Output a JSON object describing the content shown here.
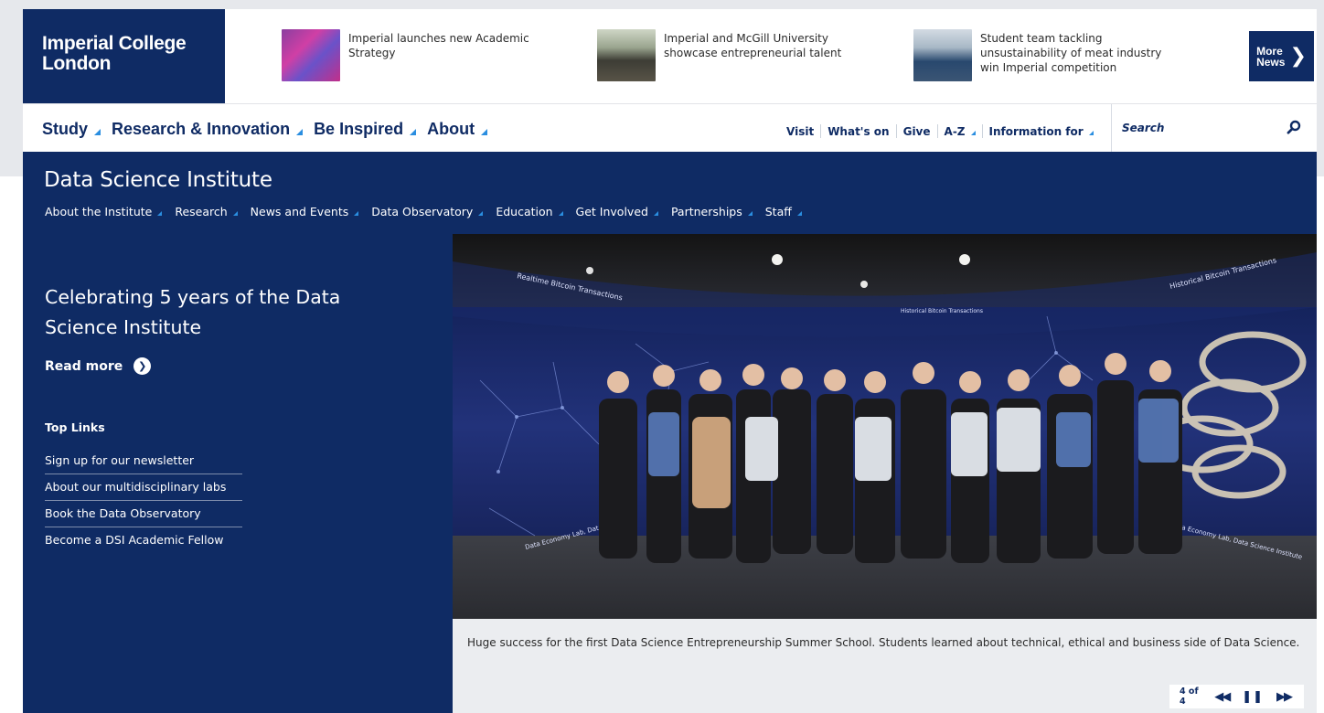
{
  "header": {
    "logo_line1": "Imperial College",
    "logo_line2": "London",
    "news": [
      {
        "title": "Imperial launches new Academic Strategy"
      },
      {
        "title": "Imperial and McGill University showcase entrepreneurial talent"
      },
      {
        "title": "Student team tackling unsustainability of meat industry win Imperial competition"
      }
    ],
    "more_news_line1": "More",
    "more_news_line2": "News"
  },
  "main_nav": {
    "items": [
      "Study",
      "Research & Innovation",
      "Be Inspired",
      "About"
    ],
    "utility": [
      "Visit",
      "What's on",
      "Give",
      "A-Z",
      "Information for"
    ],
    "search_placeholder": "Search"
  },
  "institute": {
    "title": "Data Science Institute",
    "nav": [
      "About the Institute",
      "Research",
      "News and Events",
      "Data Observatory",
      "Education",
      "Get Involved",
      "Partnerships",
      "Staff"
    ]
  },
  "hero": {
    "heading": "Celebrating 5 years of the Data Science Institute",
    "read_more": "Read more",
    "top_links_heading": "Top Links",
    "top_links": [
      "Sign up for our newsletter",
      "About our multidisciplinary labs",
      "Book the Data Observatory",
      "Become a DSI Academic Fellow"
    ]
  },
  "slideshow": {
    "caption": "Huge success for the first Data Science Entrepreneurship Summer School. Students learned about technical, ethical and business side of Data Science.",
    "counter": "4 of 4",
    "photo_labels": [
      "Realtime Bitcoin Transactions",
      "Historical Bitcoin Transactions",
      "Historical Bitcoin Transactions",
      "Data Economy Lab, Data",
      "Data Economy Lab, Data Science Institute"
    ]
  },
  "colors": {
    "navy": "#0f2b64",
    "accent": "#2a8ee0"
  },
  "icons": {
    "search": "magnifier",
    "more_news": "chevron-right",
    "read_more": "chevron-right-circle",
    "prev": "rewind",
    "pause": "pause",
    "next": "fast-forward"
  }
}
